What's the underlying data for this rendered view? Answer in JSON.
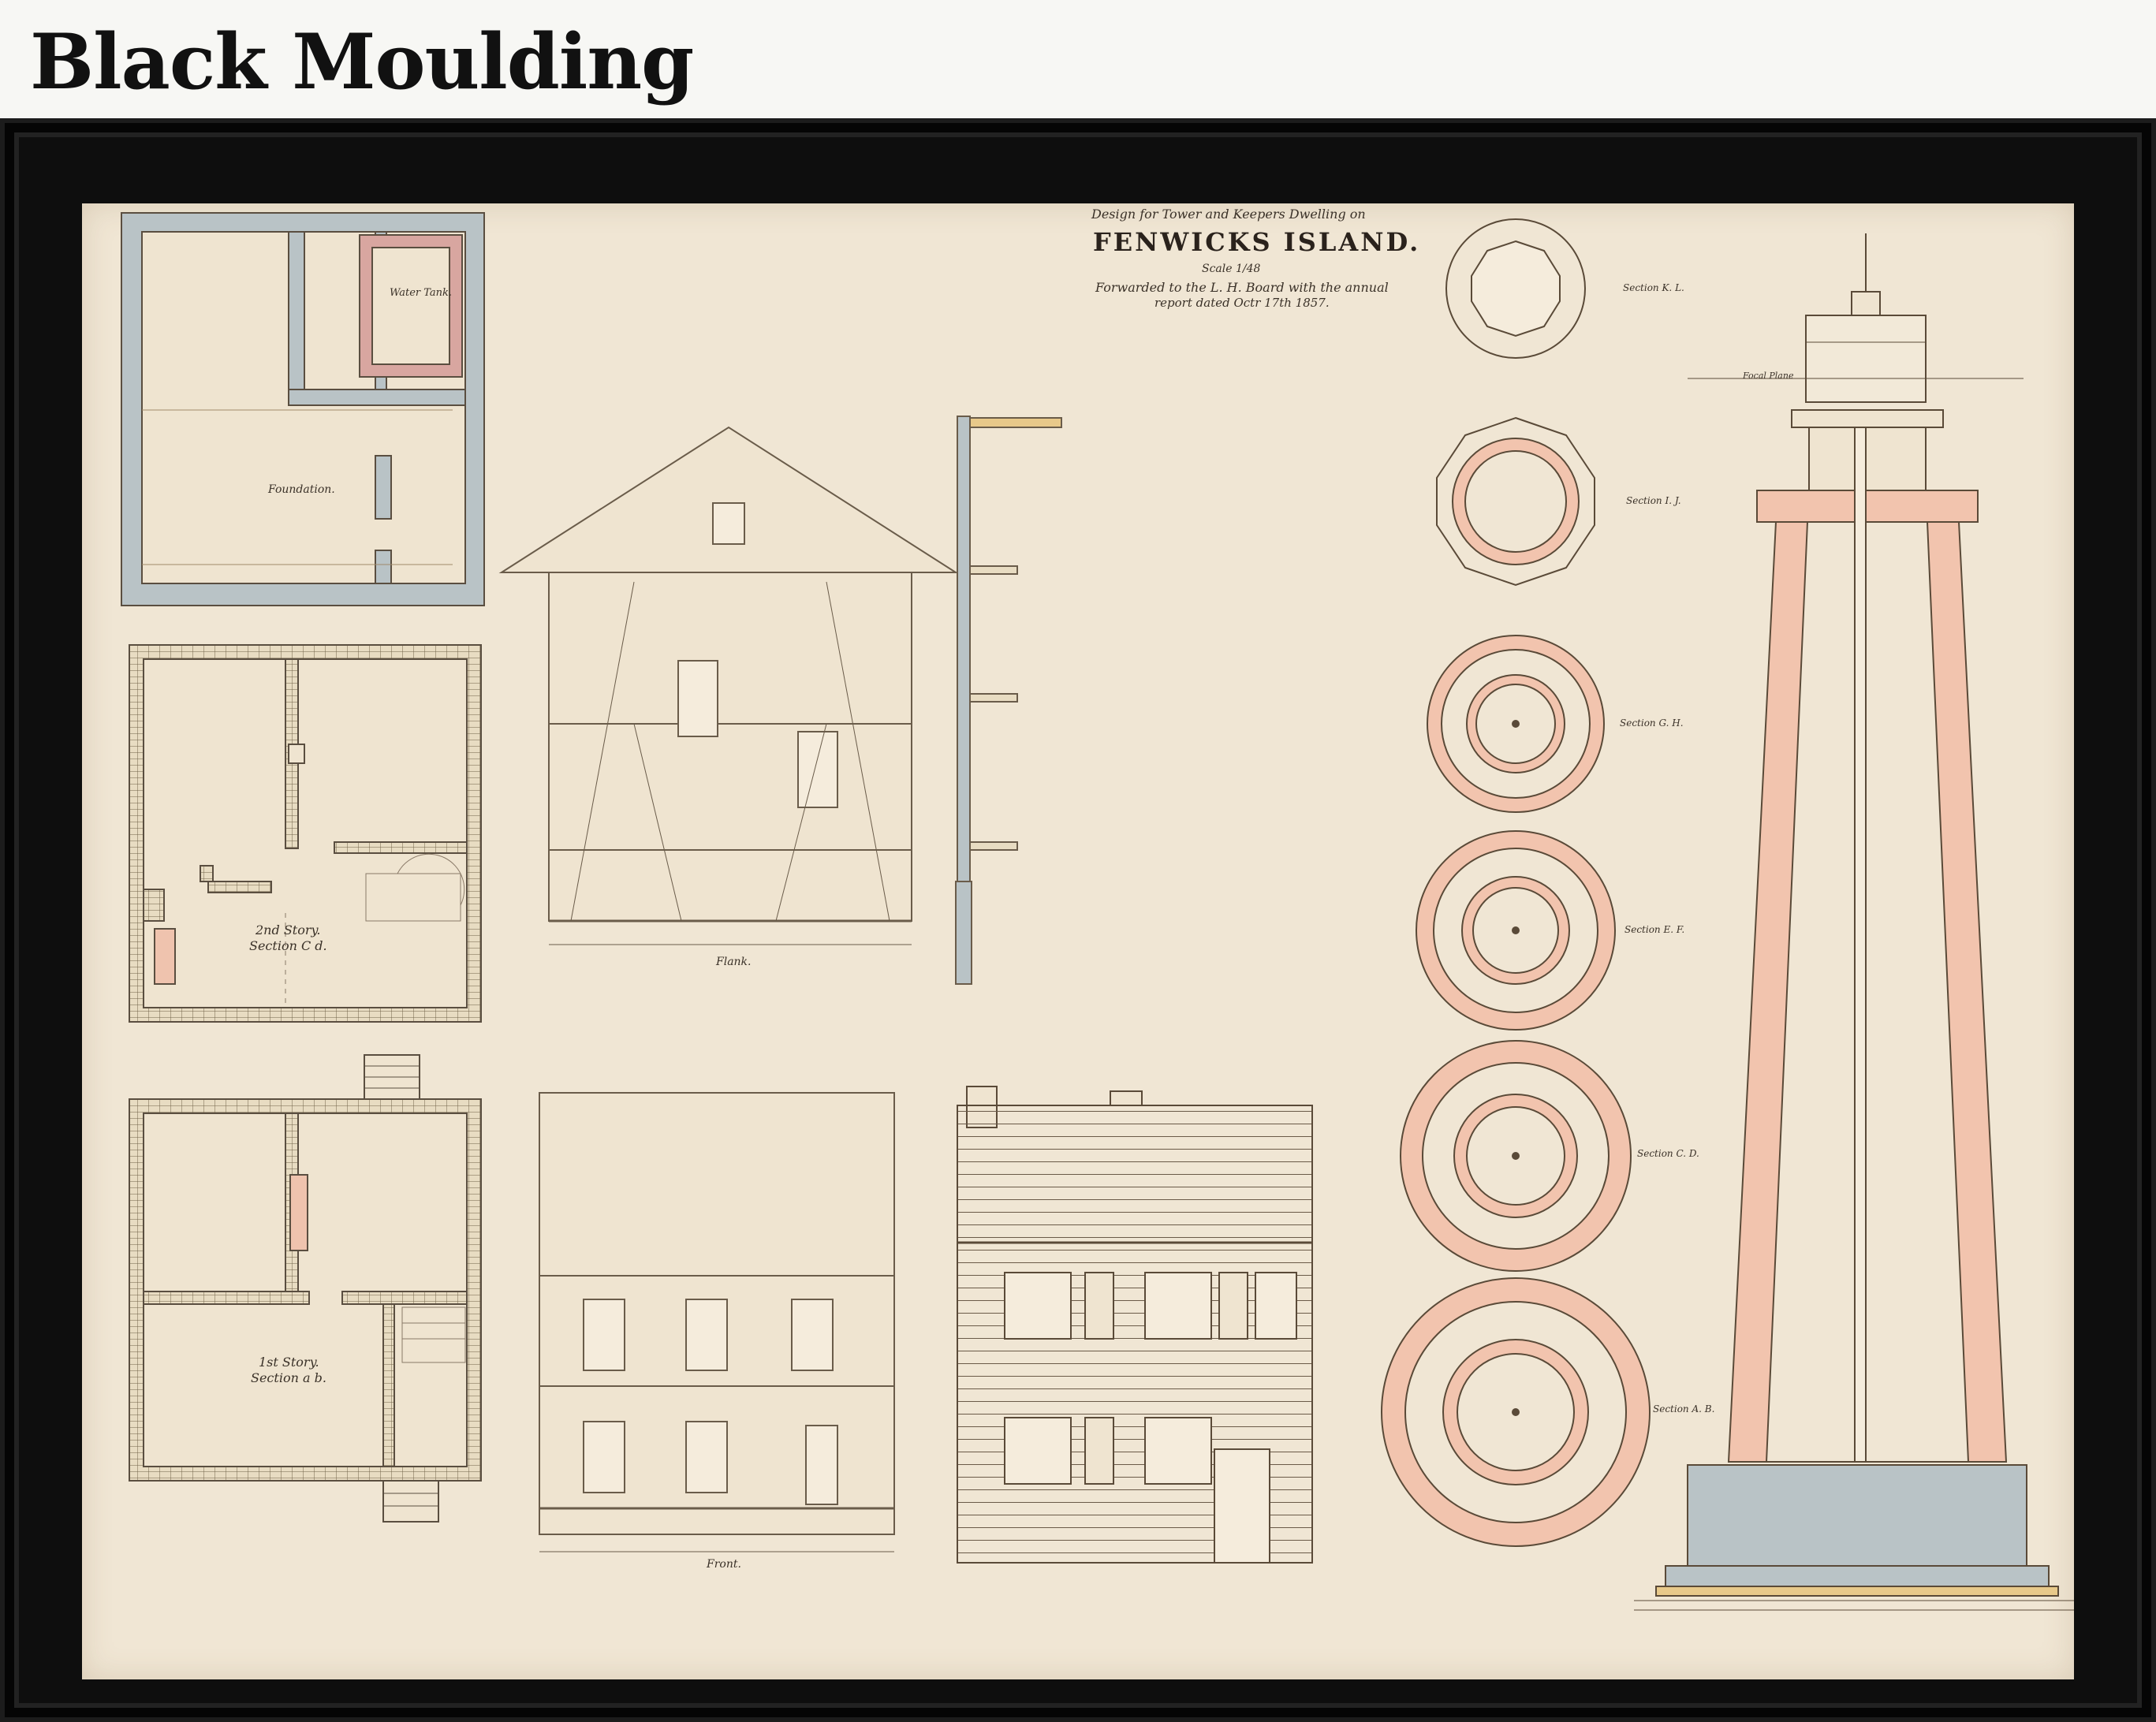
{
  "header": {
    "title": "Black Moulding"
  },
  "drawing": {
    "title_line1": "Design for Tower and Keepers Dwelling on",
    "title_main": "FENWICKS ISLAND.",
    "title_scale": "Scale 1/48",
    "title_line3": "Forwarded to the L. H. Board with the annual",
    "title_line4": "report dated Octr 17th 1857.",
    "plans": {
      "foundation": "Foundation.",
      "water_tank": "Water Tank.",
      "second_story": "2nd Story.",
      "second_section": "Section C d.",
      "first_story": "1st Story.",
      "first_section": "Section a b."
    },
    "elevations": {
      "flank": "Flank.",
      "front": "Front."
    },
    "sections": {
      "kl": "Section K. L.",
      "ij": "Section I. J.",
      "gh": "Section G. H.",
      "ef": "Section E. F.",
      "cd": "Section C. D.",
      "ab": "Section A. B."
    },
    "tower": {
      "focal_plane": "Focal Plane"
    },
    "colors": {
      "paper": "#f0e6d4",
      "ink": "#3a3128",
      "pink": "#f2c4ae",
      "stone": "#b7c2c2",
      "frame": "#0e0e0e"
    }
  }
}
